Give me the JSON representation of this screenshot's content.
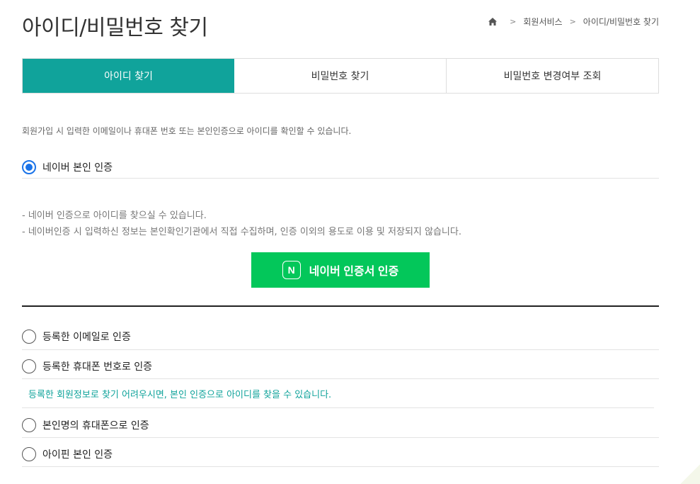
{
  "page": {
    "title": "아이디/비밀번호 찾기"
  },
  "breadcrumb": {
    "home_icon": "home-icon",
    "items": [
      "회원서비스",
      "아이디/비밀번호 찾기"
    ],
    "separator": ">"
  },
  "tabs": [
    {
      "label": "아이디 찾기",
      "active": true
    },
    {
      "label": "비밀번호 찾기",
      "active": false
    },
    {
      "label": "비밀번호 변경여부 조회",
      "active": false
    }
  ],
  "intro": "회원가입 시 입력한 이메일이나 휴대폰 번호 또는 본인인증으로 아이디를 확인할 수 있습니다.",
  "options": {
    "naver": {
      "label": "네이버 본인 인증",
      "checked": true
    },
    "email": {
      "label": "등록한 이메일로 인증",
      "checked": false
    },
    "phone": {
      "label": "등록한 휴대폰 번호로 인증",
      "checked": false
    },
    "own_phone": {
      "label": "본인명의 휴대폰으로 인증",
      "checked": false
    },
    "ipin": {
      "label": "아이핀 본인 인증",
      "checked": false
    }
  },
  "naver_notes": [
    "- 네이버 인증으로 아이디를 찾으실 수 있습니다.",
    "- 네이버인증 시 입력하신 정보는 본인확인기관에서 직접 수집하며, 인증 이외의 용도로 이용 및 저장되지 않습니다."
  ],
  "naver_button": {
    "logo": "N",
    "label": "네이버 인증서 인증"
  },
  "hint": "등록한 회원정보로 찾기 어려우시면, 본인 인증으로 아이디를 찾을 수 있습니다.",
  "colors": {
    "accent": "#10a39b",
    "naver_green": "#03c75a",
    "radio_checked": "#1a73e8"
  }
}
